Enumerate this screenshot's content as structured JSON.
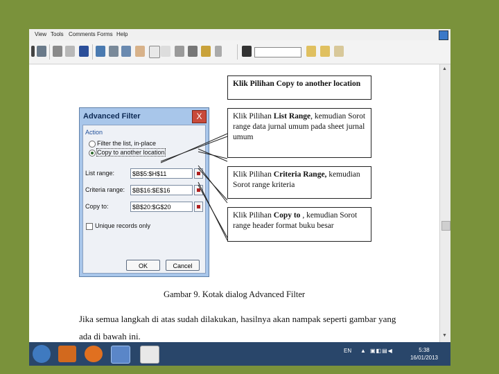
{
  "menu": [
    "View",
    "Tools",
    "Comments",
    "Forms",
    "Help"
  ],
  "dialog": {
    "title": "Advanced Filter",
    "close": "X",
    "action_label": "Action",
    "radio_filter": "Filter the list, in-place",
    "radio_copy": "Copy to another location",
    "list_range_label": "List range:",
    "list_range_value": "$B$5:$H$11",
    "criteria_range_label": "Criteria range:",
    "criteria_range_value": "$B$16:$E$16",
    "copy_to_label": "Copy to:",
    "copy_to_value": "$B$20:$G$20",
    "unique_label": "Unique records only",
    "ok": "OK",
    "cancel": "Cancel"
  },
  "callouts": [
    {
      "bold": "Klik Pilihan Copy to another location",
      "rest": ""
    },
    {
      "pre": "Klik Pilihan ",
      "bold": "List Range",
      "rest": ", kemudian Sorot range data jurnal umum pada sheet jurnal umum"
    },
    {
      "pre": "Klik Pilihan ",
      "bold": "Criteria Range,",
      "rest": " kemudian Sorot range kriteria"
    },
    {
      "pre": "Klik Pilihan ",
      "bold": "Copy to",
      "rest": " , kemudian Sorot range header format buku besar"
    }
  ],
  "caption": "Gambar 9. Kotak dialog Advanced Filter",
  "paragraph": {
    "line1": "Jika semua langkah di atas sudah dilakukan, hasilnya akan nampak seperti gambar yang",
    "line2": "ada di bawah ini."
  },
  "taskbar": {
    "lang": "EN",
    "time": "5:38",
    "date": "16/01/2013"
  }
}
